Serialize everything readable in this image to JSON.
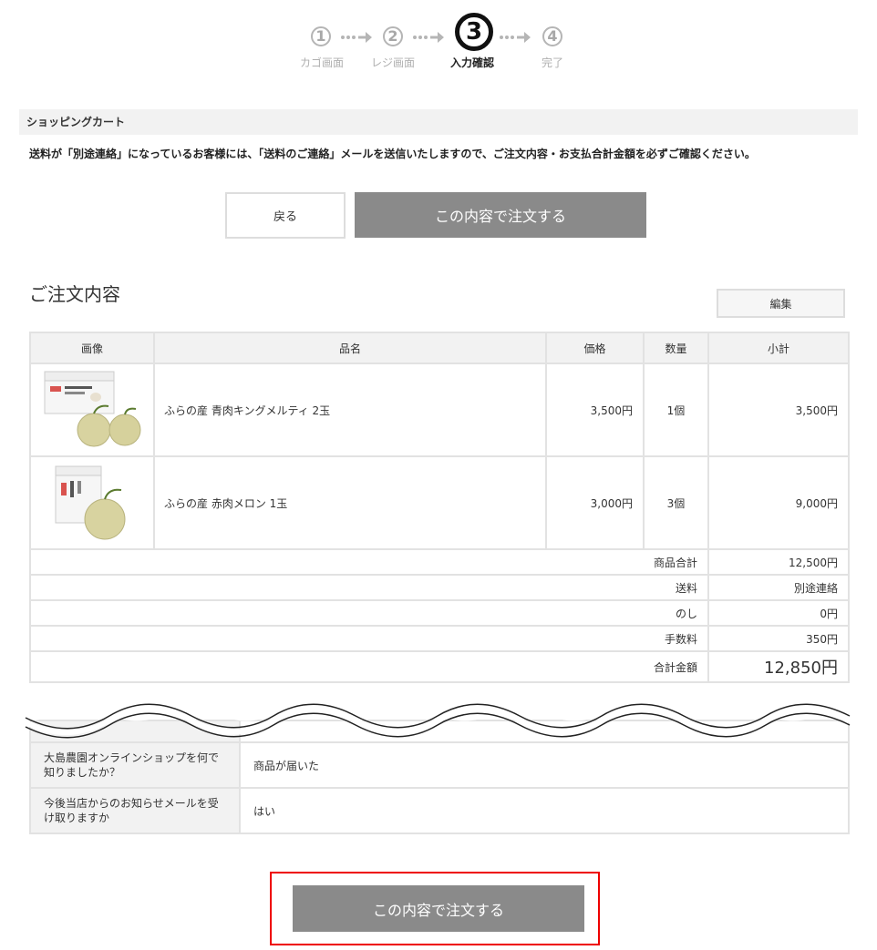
{
  "steps": [
    {
      "num": "1",
      "label": "カゴ画面"
    },
    {
      "num": "2",
      "label": "レジ画面"
    },
    {
      "num": "3",
      "label": "入力確認"
    },
    {
      "num": "4",
      "label": "完了"
    }
  ],
  "section_title": "ショッピングカート",
  "notice": "送料が「別途連絡」になっているお客様には、「送料のご連絡」メールを送信いたしますので、ご注文内容・お支払合計金額を必ずご確認ください。",
  "buttons": {
    "back": "戻る",
    "order_top": "この内容で注文する",
    "order_bottom": "この内容で注文する",
    "edit": "編集"
  },
  "order": {
    "title": "ご注文内容",
    "headers": {
      "image": "画像",
      "name": "品名",
      "price": "価格",
      "qty": "数量",
      "subtotal": "小計"
    },
    "items": [
      {
        "name": "ふらの産 青肉キングメルティ 2玉",
        "price": "3,500円",
        "qty": "1個",
        "subtotal": "3,500円"
      },
      {
        "name": "ふらの産 赤肉メロン 1玉",
        "price": "3,000円",
        "qty": "3個",
        "subtotal": "9,000円"
      }
    ],
    "summary": {
      "goods_total_label": "商品合計",
      "goods_total": "12,500円",
      "shipping_label": "送料",
      "shipping": "別途連絡",
      "noshi_label": "のし",
      "noshi": "0円",
      "fee_label": "手数料",
      "fee": "350円",
      "grand_total_label": "合計金額",
      "grand_total": "12,850円"
    }
  },
  "survey": [
    {
      "q": "大島農園オンラインショップを何で知りましたか？",
      "a": "商品が届いた"
    },
    {
      "q": "今後当店からのお知らせメールを受け取りますか",
      "a": "はい"
    }
  ],
  "colors": {
    "button_gray": "#8a8a8a",
    "highlight_red": "#e00000"
  }
}
